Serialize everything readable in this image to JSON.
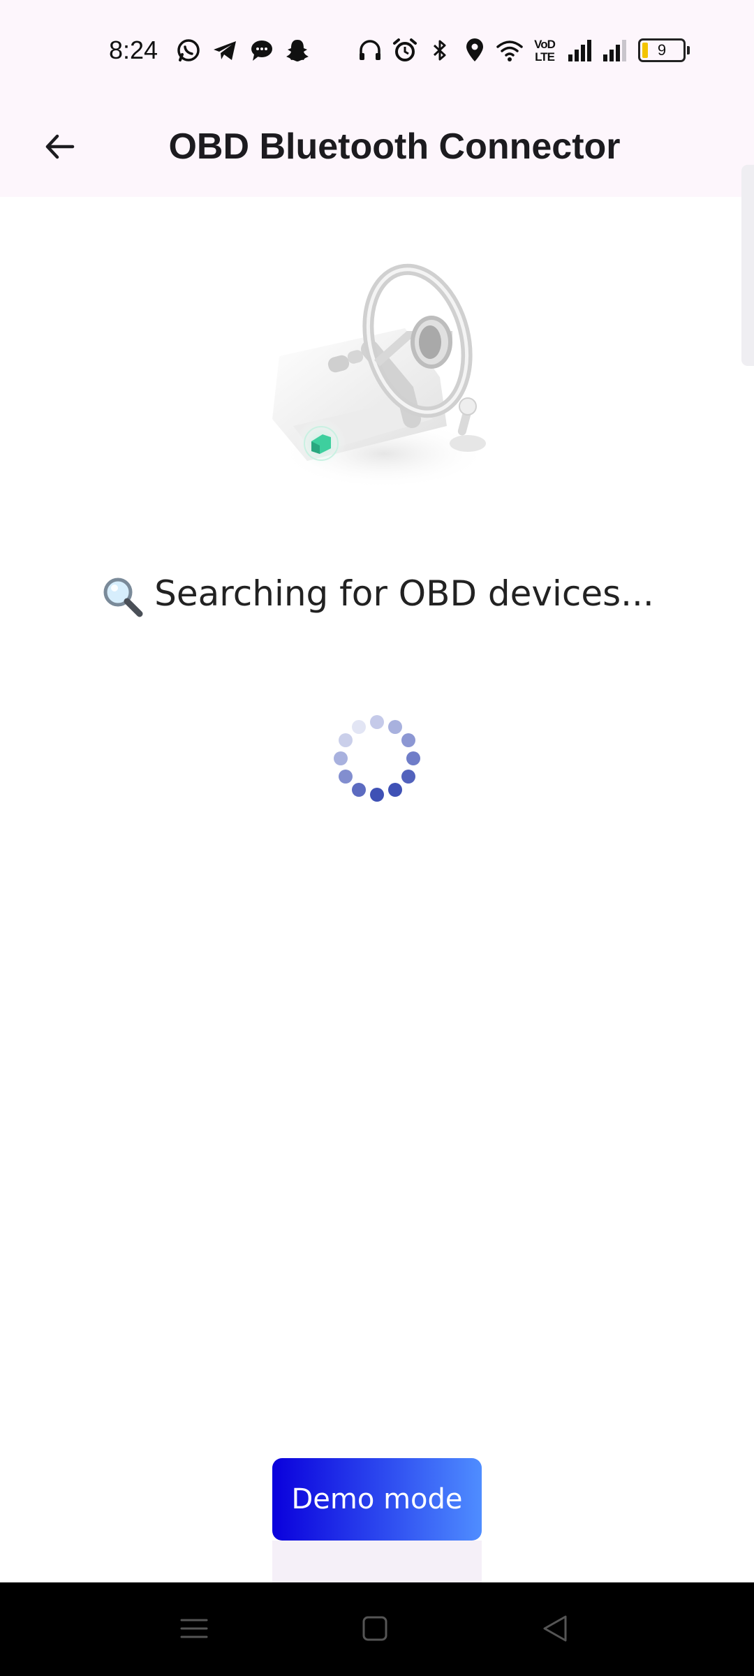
{
  "status_bar": {
    "time": "8:24",
    "left_icons": [
      "whatsapp-icon",
      "telegram-icon",
      "chat-bubble-icon",
      "snapchat-icon"
    ],
    "right_icons": [
      "headphones-icon",
      "alarm-icon",
      "bluetooth-icon",
      "location-icon",
      "wifi-icon",
      "volte-icon",
      "signal-icon",
      "signal-icon"
    ],
    "volte_label": "VoD\nLTE",
    "battery_level": "9"
  },
  "app_bar": {
    "back_icon": "arrow-left-icon",
    "title": "OBD Bluetooth Connector"
  },
  "main": {
    "illustration": "steering-wheel-obd-illustration",
    "status_emoji": "magnifying-glass-icon",
    "status_text": "Searching for OBD devices...",
    "spinner": "loading-spinner"
  },
  "demo_button": {
    "label": "Demo mode"
  },
  "nav_bar": {
    "icons": [
      "menu-icon",
      "home-icon",
      "back-triangle-icon"
    ]
  },
  "colors": {
    "app_bar_bg": "#fdf6fc",
    "demo_gradient_start": "#0a00dc",
    "demo_gradient_end": "#4f8dff",
    "spinner": "#3f51b5",
    "obd_accent": "#3ecf9e"
  }
}
